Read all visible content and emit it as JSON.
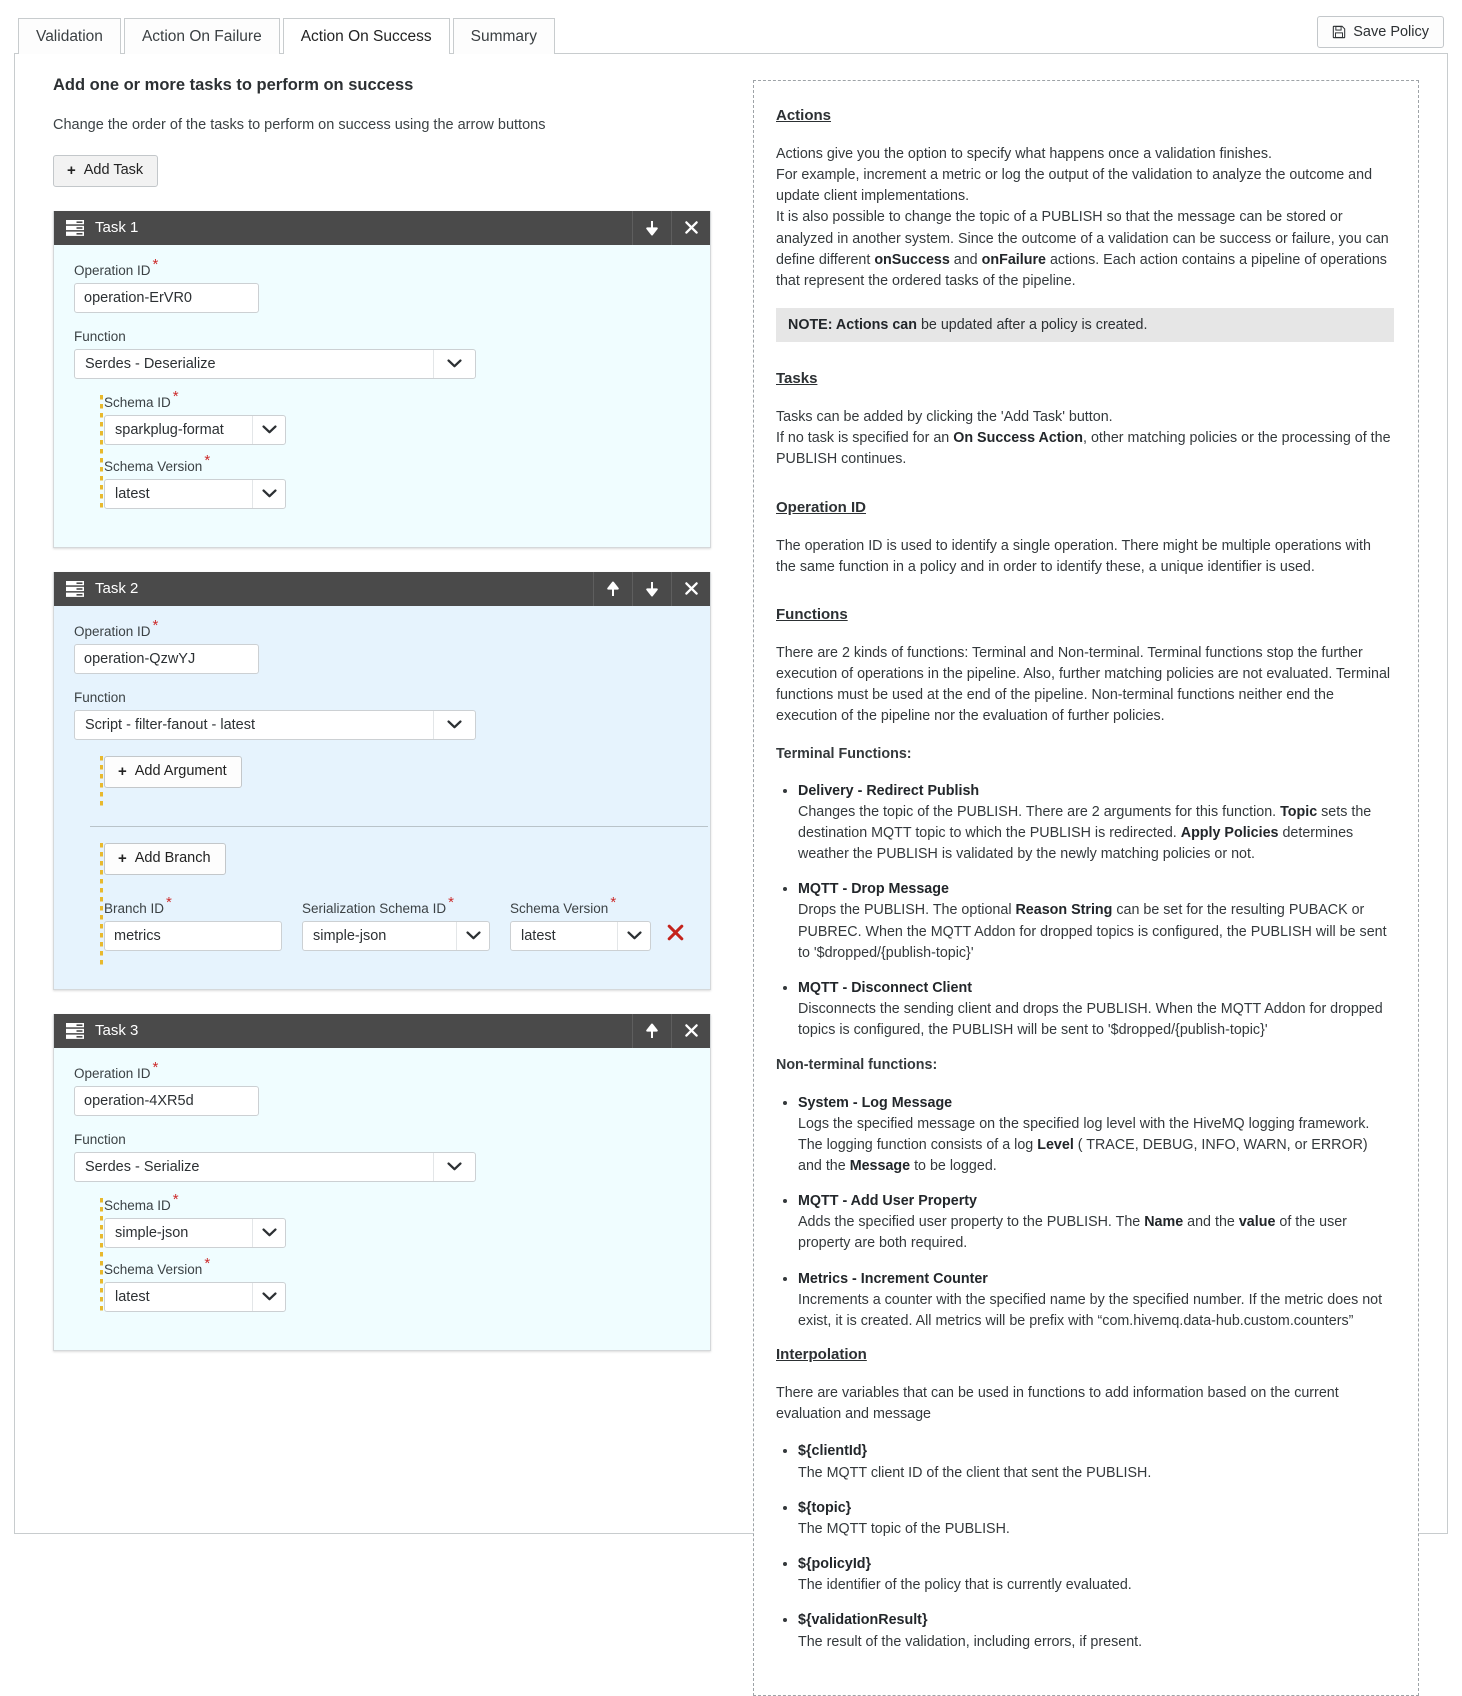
{
  "tabs": [
    {
      "label": "Validation",
      "active": false
    },
    {
      "label": "Action On Failure",
      "active": false
    },
    {
      "label": "Action On Success",
      "active": true
    },
    {
      "label": "Summary",
      "active": false
    }
  ],
  "toolbar": {
    "save_label": "Save Policy",
    "save_icon": "floppy-disk-icon"
  },
  "main": {
    "title": "Add one or more tasks to perform on success",
    "subtitle": "Change the order of the tasks to perform on success using the arrow buttons",
    "add_task_label": "Add Task"
  },
  "labels": {
    "operation_id": "Operation ID",
    "function": "Function",
    "schema_id": "Schema ID",
    "schema_version": "Schema Version",
    "branch_id": "Branch ID",
    "serialization_schema_id": "Serialization Schema ID",
    "add_argument": "Add Argument",
    "add_branch": "Add Branch"
  },
  "tasks": [
    {
      "title": "Task 1",
      "theme": "cyan",
      "operation_id": "operation-ErVR0",
      "function": "Serdes - Deserialize",
      "schema_id": "sparkplug-format",
      "schema_version": "latest",
      "has_up": false,
      "has_down": true
    },
    {
      "title": "Task 2",
      "theme": "blue",
      "operation_id": "operation-QzwYJ",
      "function": "Script - filter-fanout - latest",
      "has_up": true,
      "has_down": true,
      "branch": {
        "branch_id": "metrics",
        "serialization_schema_id": "simple-json",
        "schema_version": "latest"
      }
    },
    {
      "title": "Task 3",
      "theme": "cyan",
      "operation_id": "operation-4XR5d",
      "function": "Serdes - Serialize",
      "schema_id": "simple-json",
      "schema_version": "latest",
      "has_up": true,
      "has_down": false
    }
  ],
  "docs": {
    "actions_heading": "Actions",
    "actions_p1": "Actions give you the option to specify what happens once a validation finishes.",
    "actions_p2": "For example, increment a metric or log the output of the validation to analyze the outcome and update client implementations.",
    "actions_p3_a": "It is also possible to change the topic of a PUBLISH so that the message can be stored or analyzed in another system. Since the outcome of a validation can be  success or failure, you can define different ",
    "actions_p3_b": "onSuccess",
    "actions_p3_c": " and ",
    "actions_p3_d": "onFailure",
    "actions_p3_e": " actions. Each action contains a pipeline of operations that represent the ordered tasks of the pipeline.",
    "note_a": "NOTE: Actions ",
    "note_b": "can",
    "note_c": " be updated after a policy is created.",
    "tasks_heading": "Tasks",
    "tasks_p1": "Tasks can be added by clicking the 'Add Task' button.",
    "tasks_p2_a": "If no task is specified for an ",
    "tasks_p2_b": "On Success Action",
    "tasks_p2_c": ", other matching policies or the processing of the PUBLISH continues.",
    "opid_heading": "Operation ID",
    "opid_p": "The operation ID is used to identify a single operation. There might be multiple operations with the same function in a policy and in order to identify these, a unique identifier is used.",
    "functions_heading": "Functions",
    "functions_p": "There are 2 kinds of functions: Terminal and Non-terminal. Terminal functions stop the further execution of operations in the pipeline. Also, further matching policies are not evaluated. Terminal functions must be used at the end of the pipeline. Non-terminal functions neither end the execution of the pipeline nor the evaluation of further policies.",
    "terminal_heading": "Terminal Functions:",
    "terminal_items": [
      {
        "name": "Delivery - Redirect Publish",
        "desc_a": "Changes the topic of the PUBLISH. There are 2 arguments for this function. ",
        "bold_1": "Topic",
        "desc_b": " sets the destination MQTT topic to which the PUBLISH is redirected. ",
        "bold_2": "Apply Policies",
        "desc_c": " determines weather the PUBLISH is validated by the newly matching policies or not."
      },
      {
        "name": "MQTT - Drop Message",
        "desc_a": "Drops the PUBLISH. The optional ",
        "bold_1": "Reason String",
        "desc_b": " can be set for the resulting PUBACK or PUBREC. When the MQTT Addon for dropped topics is configured, the PUBLISH will be sent to '$dropped/{publish-topic}'",
        "bold_2": "",
        "desc_c": ""
      },
      {
        "name": "MQTT - Disconnect Client",
        "desc_a": "Disconnects the sending client and drops the PUBLISH. When the MQTT Addon for dropped topics is configured, the PUBLISH will be sent to '$dropped/{publish-topic}'",
        "bold_1": "",
        "desc_b": "",
        "bold_2": "",
        "desc_c": ""
      }
    ],
    "nonterminal_heading": "Non-terminal functions:",
    "nonterminal_items": [
      {
        "name": "System - Log Message",
        "desc_a": "Logs the specified message on the specified log level with the HiveMQ logging framework. The logging function consists of a log ",
        "bold_1": "Level",
        "desc_b": " ( TRACE, DEBUG, INFO, WARN, or ERROR) and the ",
        "bold_2": "Message",
        "desc_c": " to be logged."
      },
      {
        "name": "MQTT - Add User Property",
        "desc_a": "Adds the specified user property to the PUBLISH. The ",
        "bold_1": "Name",
        "desc_b": " and the ",
        "bold_2": "value",
        "desc_c": " of the user property are both required."
      },
      {
        "name": "Metrics - Increment Counter",
        "desc_a": "Increments a counter with the specified name by the specified number. If the metric does not exist, it is created. All metrics will be prefix with “com.hivemq.data-hub.custom.counters”",
        "bold_1": "",
        "desc_b": "",
        "bold_2": "",
        "desc_c": ""
      }
    ],
    "interpolation_heading": "Interpolation",
    "interpolation_p": "There are variables that can be used in functions to add information based on the current evaluation and message",
    "interpolation_items": [
      {
        "name": "${clientId}",
        "desc": "The MQTT client ID of the client that sent the PUBLISH."
      },
      {
        "name": "${topic}",
        "desc": "The MQTT topic of the PUBLISH."
      },
      {
        "name": "${policyId}",
        "desc": "The identifier of the policy that is currently evaluated."
      },
      {
        "name": "${validationResult}",
        "desc": "The result of the validation, including errors, if present."
      }
    ]
  }
}
